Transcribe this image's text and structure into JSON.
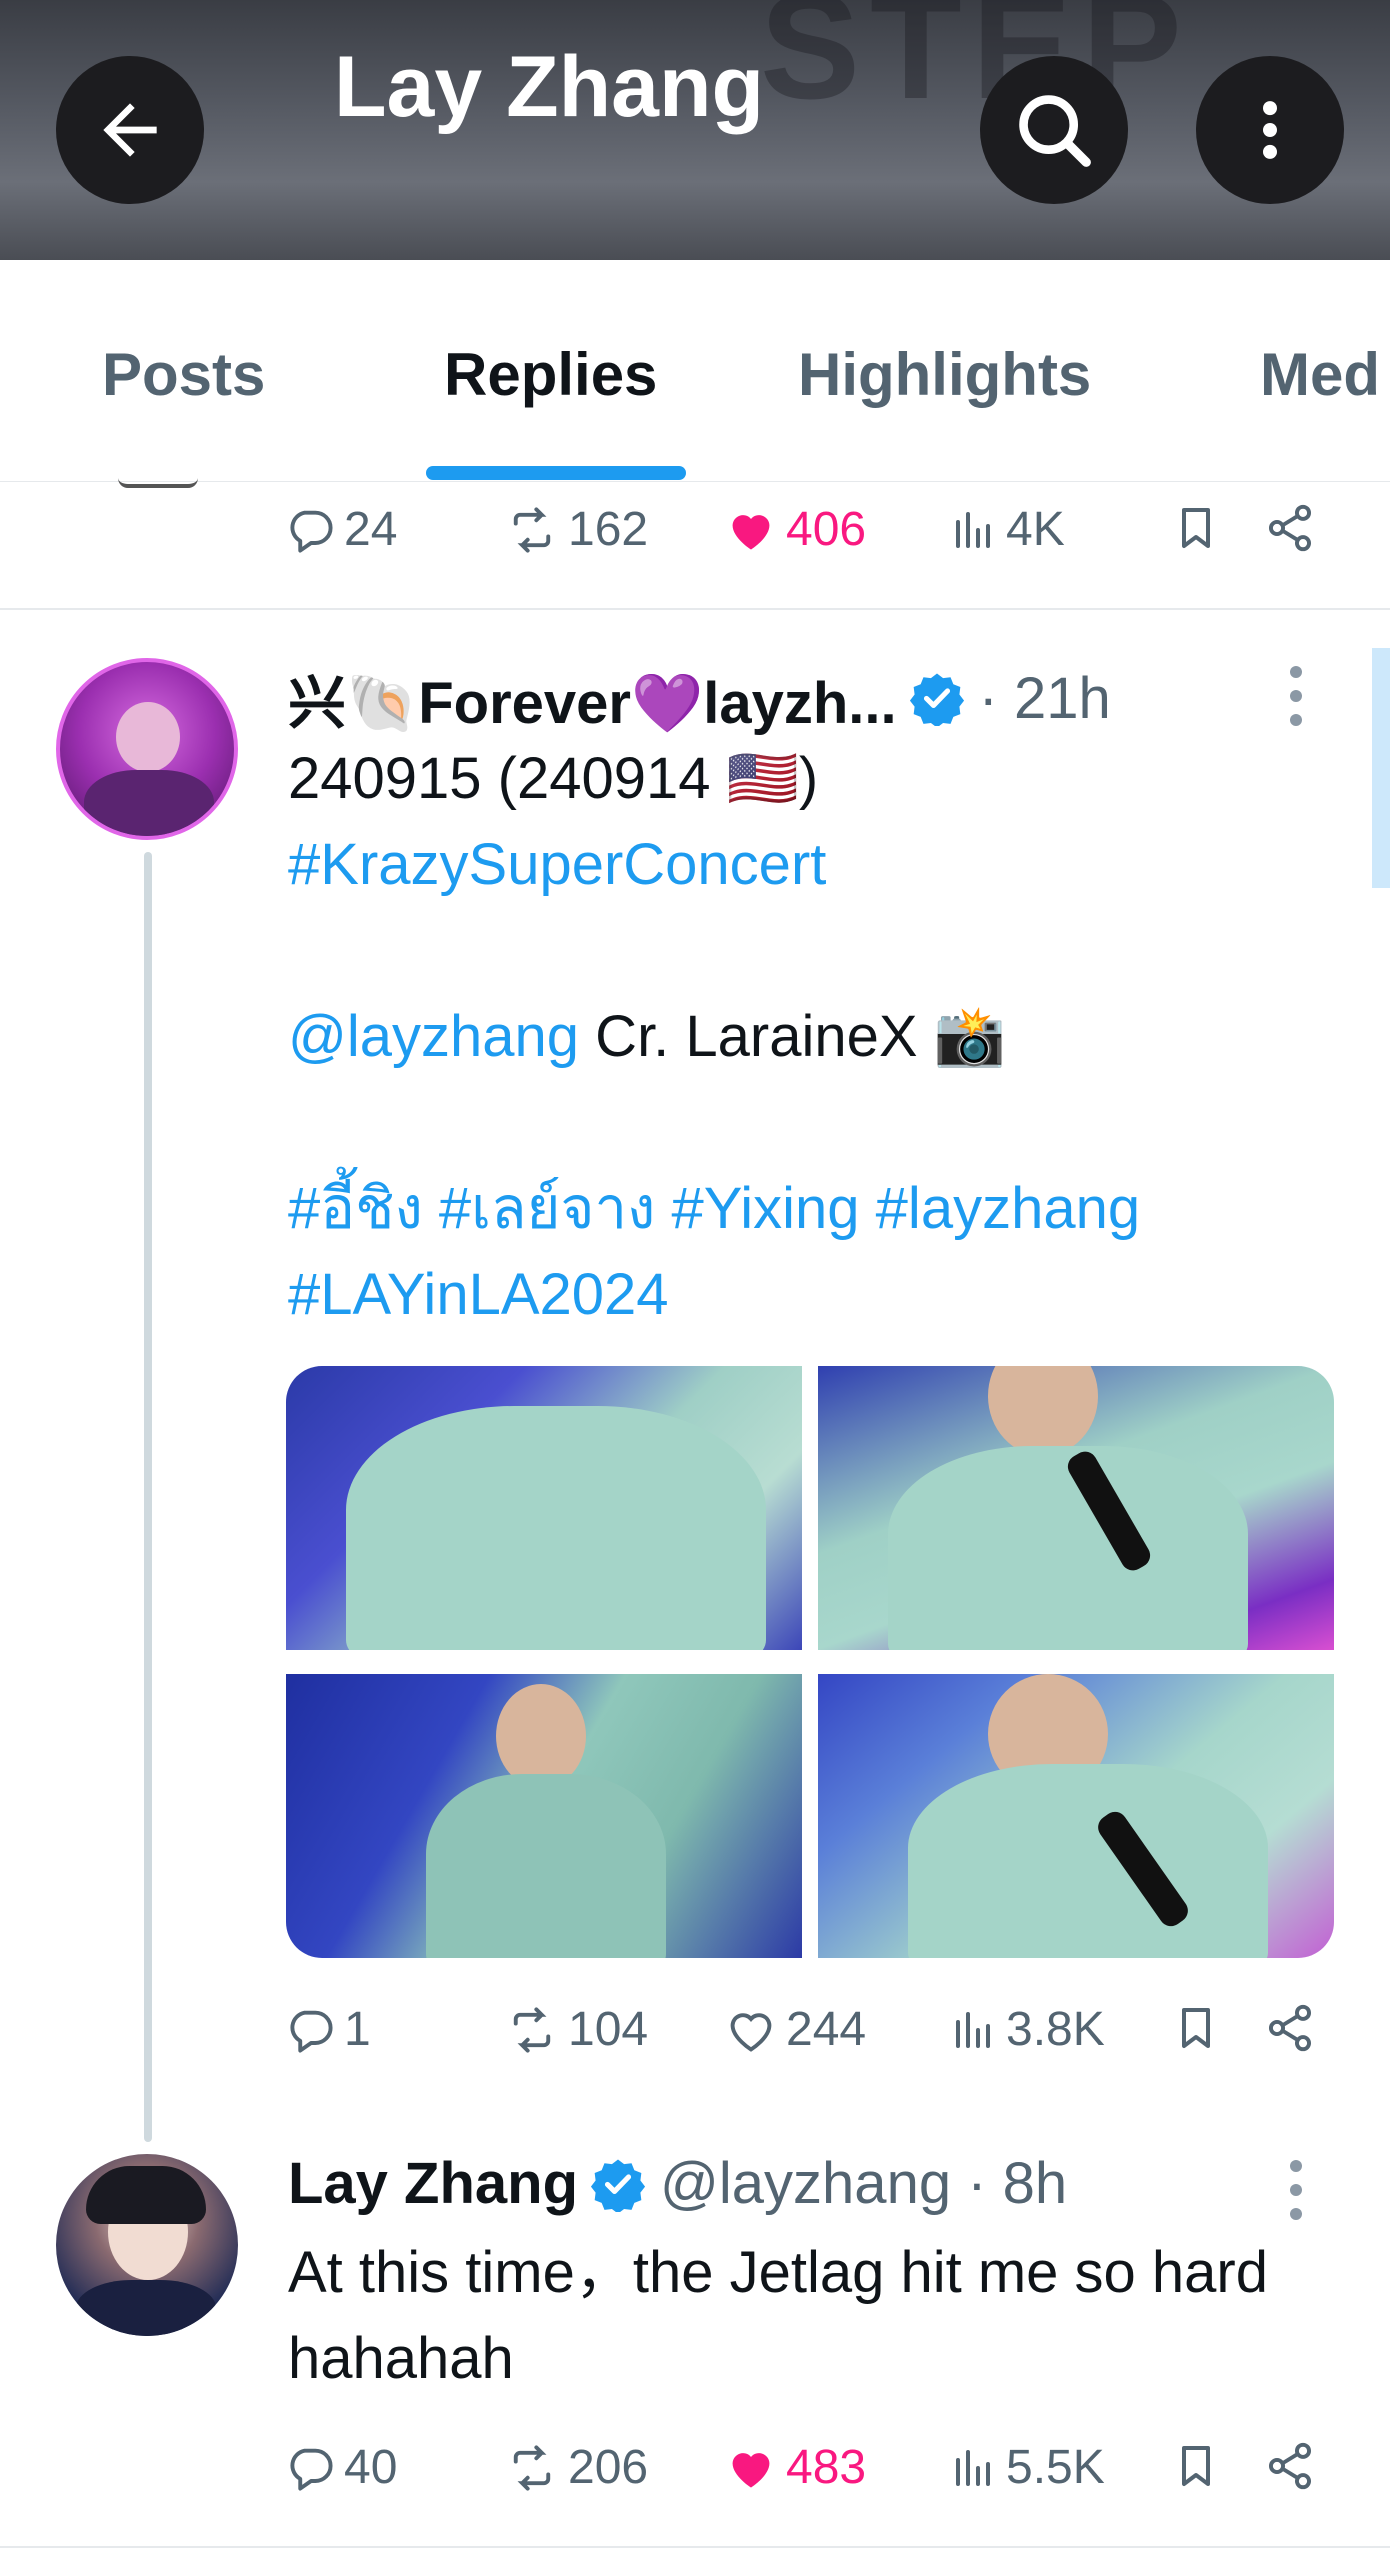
{
  "header": {
    "title": "Lay Zhang"
  },
  "tabs": [
    {
      "label": "Posts"
    },
    {
      "label": "Replies"
    },
    {
      "label": "Highlights"
    },
    {
      "label": "Med"
    }
  ],
  "prev_tweet_actions": {
    "replies": "24",
    "reposts": "162",
    "likes": "406",
    "views": "4K"
  },
  "tweet1": {
    "name": "兴🐚Forever💜layzh...",
    "time": "· 21h",
    "line1": "240915 (240914 🇺🇸)",
    "hashtag1": "#KrazySuperConcert",
    "mention": "@layzhang",
    "credit": " Cr. LaraineX 📸",
    "hashtags_line1": "#อี้ชิง #เลย์จาง #Yixing #layzhang",
    "hashtags_line2": "#LAYinLA2024",
    "actions": {
      "replies": "1",
      "reposts": "104",
      "likes": "244",
      "views": "3.8K"
    }
  },
  "tweet2": {
    "name": "Lay Zhang",
    "handle_time": "@layzhang · 8h",
    "text": "At this time，the Jetlag hit me so hard hahahah",
    "actions": {
      "replies": "40",
      "reposts": "206",
      "likes": "483",
      "views": "5.5K"
    }
  },
  "colors": {
    "accent": "#1d9bf0",
    "like": "#f91880",
    "muted": "#536471"
  },
  "icons": [
    "back-arrow-icon",
    "search-icon",
    "more-vertical-icon",
    "reply-icon",
    "repost-icon",
    "heart-icon",
    "views-icon",
    "bookmark-icon",
    "share-icon",
    "verified-badge-icon"
  ]
}
